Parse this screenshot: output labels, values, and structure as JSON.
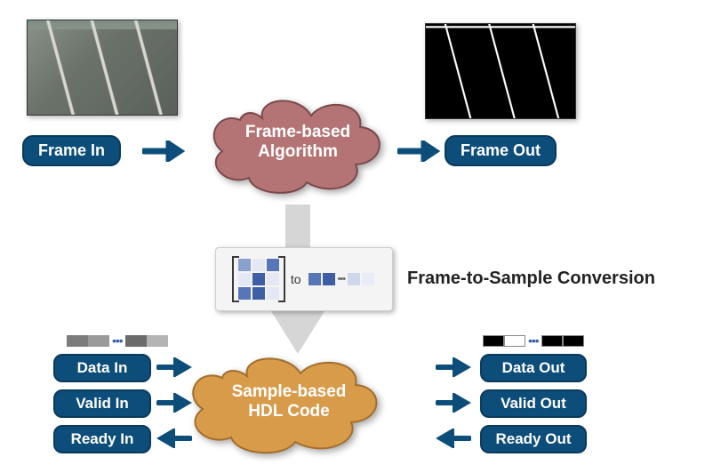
{
  "top": {
    "frame_in_label": "Frame In",
    "frame_out_label": "Frame Out",
    "cloud_line1": "Frame-based",
    "cloud_line2": "Algorithm",
    "cloud_color": "#b47475",
    "image_in_desc": "Grayscale highway camera input frame",
    "image_out_desc": "Binary edge-detected output frame"
  },
  "conversion": {
    "box_to_text": "to",
    "label": "Frame-to-Sample Conversion"
  },
  "bottom": {
    "cloud_line1": "Sample-based",
    "cloud_line2": "HDL Code",
    "cloud_color": "#d89b4a",
    "inputs": {
      "data_in": "Data In",
      "valid_in": "Valid In",
      "ready_in": "Ready In"
    },
    "outputs": {
      "data_out": "Data Out",
      "valid_out": "Valid Out",
      "ready_out": "Ready Out"
    }
  },
  "colors": {
    "badge_bg": "#0d4d7a",
    "badge_text": "#ffffff",
    "arrow": "#0d4d7a",
    "big_arrow": "#d6d6d6"
  }
}
